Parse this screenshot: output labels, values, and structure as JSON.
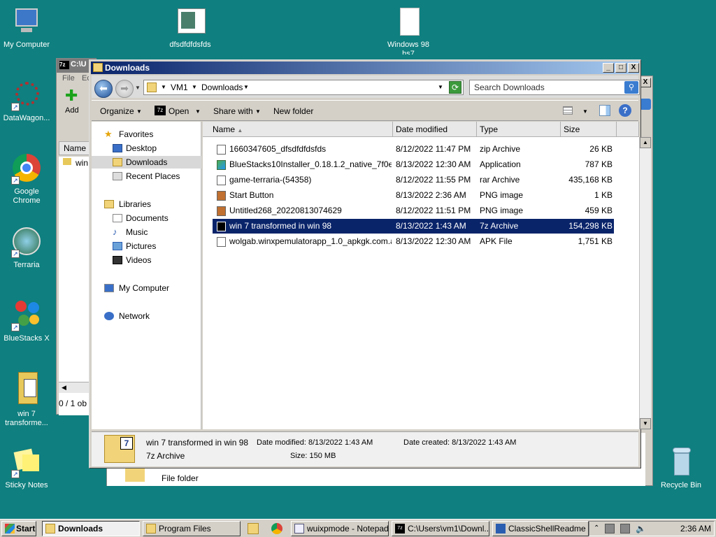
{
  "desktop": {
    "icons": [
      {
        "label": "My Computer"
      },
      {
        "label": "dfsdfdfdsfds"
      },
      {
        "label": "Windows 98 hs7"
      },
      {
        "label": "DataWagon..."
      },
      {
        "label": "Google Chrome"
      },
      {
        "label": "Terraria"
      },
      {
        "label": "BlueStacks X"
      },
      {
        "label": "win 7 transforme..."
      },
      {
        "label": "Sticky Notes"
      },
      {
        "label": "Recycle Bin"
      }
    ]
  },
  "back_window_7z": {
    "title": "C:\\U",
    "menu_file": "File",
    "menu_edit": "Ec",
    "add_label": "Add",
    "col_name": "Name",
    "row_label": "win",
    "status": "0 / 1 ob"
  },
  "back_window_pf": {
    "row_type": "File folder"
  },
  "window": {
    "title": "Downloads",
    "btn_min": "_",
    "btn_max": "□",
    "btn_close": "X",
    "breadcrumb": [
      "VM1",
      "Downloads"
    ],
    "search_placeholder": "Search Downloads",
    "toolbar": {
      "organize": "Organize",
      "open": "Open",
      "share_with": "Share with",
      "new_folder": "New folder"
    },
    "nav": {
      "favorites": "Favorites",
      "desktop": "Desktop",
      "downloads": "Downloads",
      "recent": "Recent Places",
      "libraries": "Libraries",
      "documents": "Documents",
      "music": "Music",
      "pictures": "Pictures",
      "videos": "Videos",
      "my_computer": "My Computer",
      "network": "Network"
    },
    "columns": {
      "name": "Name",
      "date": "Date modified",
      "type": "Type",
      "size": "Size"
    },
    "files": [
      {
        "name": "1660347605_dfsdfdfdsfds",
        "date": "8/12/2022 11:47 PM",
        "type": "zip Archive",
        "size": "26 KB"
      },
      {
        "name": "BlueStacks10Installer_0.18.1.2_native_7f0e...",
        "date": "8/13/2022 12:30 AM",
        "type": "Application",
        "size": "787 KB"
      },
      {
        "name": "game-terraria-(54358)",
        "date": "8/12/2022 11:55 PM",
        "type": "rar Archive",
        "size": "435,168 KB"
      },
      {
        "name": "Start Button",
        "date": "8/13/2022 2:36 AM",
        "type": "PNG image",
        "size": "1 KB"
      },
      {
        "name": "Untitled268_20220813074629",
        "date": "8/12/2022 11:51 PM",
        "type": "PNG image",
        "size": "459 KB"
      },
      {
        "name": "win 7 transformed in win 98",
        "date": "8/13/2022 1:43 AM",
        "type": "7z Archive",
        "size": "154,298 KB"
      },
      {
        "name": "wolgab.winxpemulatorapp_1.0_apkgk.com.apk",
        "date": "8/13/2022 12:30 AM",
        "type": "APK File",
        "size": "1,751 KB"
      }
    ],
    "details": {
      "name": "win 7 transformed in win 98",
      "type": "7z Archive",
      "date_modified": "Date modified: 8/13/2022 1:43 AM",
      "date_created": "Date created: 8/13/2022 1:43 AM",
      "size": "Size: 150 MB"
    }
  },
  "taskbar": {
    "start": "Start",
    "tasks": [
      "Downloads",
      "Program Files",
      "wuixpmode - Notepad",
      "C:\\Users\\vm1\\Downl...",
      "ClassicShellReadme -..."
    ],
    "clock": "2:36 AM"
  },
  "colors": {
    "desktop": "#0f7f7f",
    "selection": "#0a246a",
    "chrome_face": "#d4d0c8"
  }
}
